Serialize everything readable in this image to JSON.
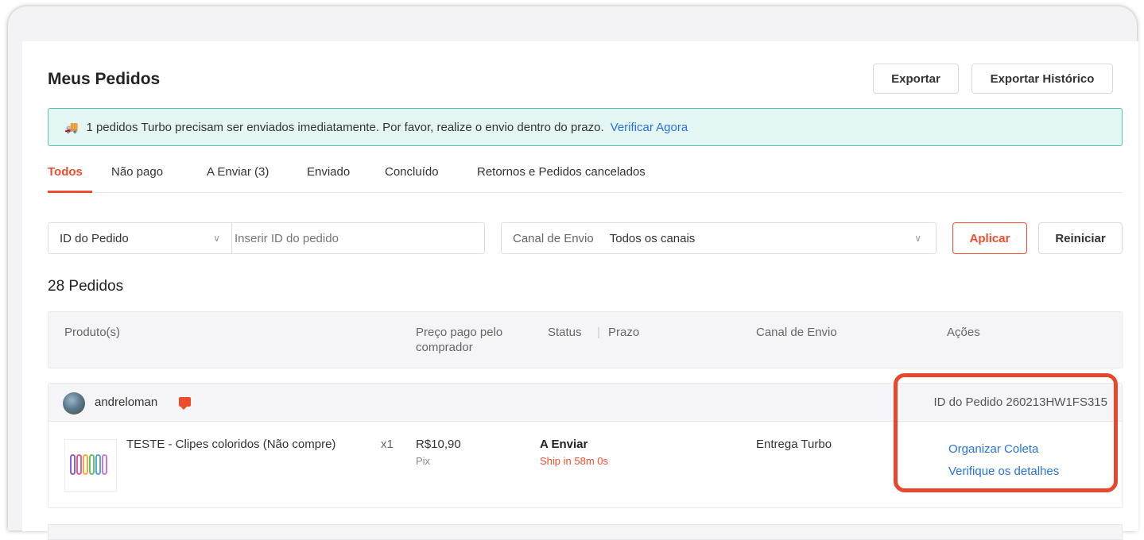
{
  "page": {
    "title": "Meus Pedidos",
    "export_label": "Exportar",
    "export_history_label": "Exportar Histórico"
  },
  "alert": {
    "icon": "truck-icon",
    "message": "1 pedidos Turbo precisam ser enviados imediatamente. Por favor, realize o envio dentro do prazo.",
    "link": "Verificar Agora"
  },
  "tabs": [
    {
      "label": "Todos",
      "active": true
    },
    {
      "label": "Não pago"
    },
    {
      "label": "A Enviar (3)"
    },
    {
      "label": "Enviado"
    },
    {
      "label": "Concluído"
    },
    {
      "label": "Retornos e Pedidos cancelados"
    }
  ],
  "filters": {
    "search_type": "ID do Pedido",
    "search_placeholder": "Inserir ID do pedido",
    "channel_label": "Canal de Envio",
    "channel_value": "Todos os canais",
    "apply_label": "Aplicar",
    "reset_label": "Reiniciar"
  },
  "count_label": "28 Pedidos",
  "table_headers": {
    "products": "Produto(s)",
    "price": "Preço pago pelo comprador",
    "status": "Status",
    "deadline": "Prazo",
    "channel": "Canal de Envio",
    "actions": "Ações"
  },
  "order": {
    "buyer": "andreloman",
    "order_id": "ID do Pedido 260213HW1FS315",
    "product_name": "TESTE - Clipes coloridos (Não compre)",
    "quantity": "x1",
    "price": "R$10,90",
    "payment_method": "Pix",
    "status": "A Enviar",
    "deadline": "Ship in 58m 0s",
    "channel": "Entrega Turbo",
    "actions": [
      "Organizar Coleta",
      "Verifique os detalhes"
    ]
  },
  "colors": {
    "accent": "#ee4d2d",
    "link": "#2673dd",
    "alert_bg": "#e4f6f3",
    "alert_border": "#5bc3b2",
    "highlight": "#e8472d"
  }
}
